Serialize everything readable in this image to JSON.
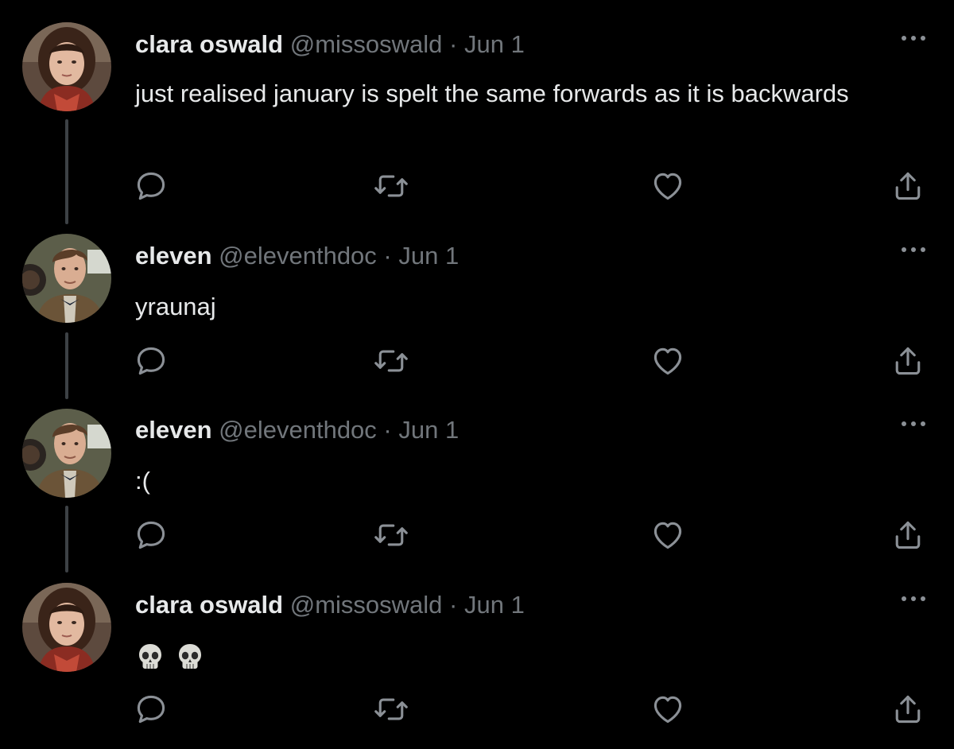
{
  "colors": {
    "background": "#000000",
    "text": "#e7e9ea",
    "secondary": "#71767b",
    "thread_line": "#3d4145"
  },
  "separator": "·",
  "tweets": [
    {
      "name": "clara oswald",
      "handle": "@missoswald",
      "date": "Jun 1",
      "text": "just realised january is spelt the same forwards as it is backwards",
      "avatar": "clara-avatar"
    },
    {
      "name": "eleven",
      "handle": "@eleventhdoc",
      "date": "Jun 1",
      "text": "yraunaj",
      "avatar": "eleven-avatar"
    },
    {
      "name": "eleven",
      "handle": "@eleventhdoc",
      "date": "Jun 1",
      "text": ":(",
      "avatar": "eleven-avatar"
    },
    {
      "name": "clara oswald",
      "handle": "@missoswald",
      "date": "Jun 1",
      "text": "",
      "emoji": [
        "skull-icon",
        "skull-icon"
      ],
      "avatar": "clara-avatar"
    }
  ],
  "actions": [
    "reply-icon",
    "retweet-icon",
    "like-icon",
    "share-icon"
  ]
}
